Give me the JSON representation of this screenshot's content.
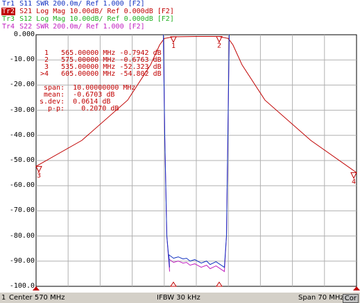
{
  "traces": [
    {
      "tag": "Tr1",
      "param": "S11",
      "fmt": "SWR 200.0m/ Ref 1.000 [F2]",
      "color": "#1030c0",
      "active": false
    },
    {
      "tag": "Tr2",
      "param": "S21",
      "fmt": "Log Mag 10.00dB/ Ref 0.000dB [F2]",
      "color": "#c00000",
      "active": true
    },
    {
      "tag": "Tr3",
      "param": "S12",
      "fmt": "Log Mag 10.00dB/ Ref 0.000dB [F2]",
      "color": "#20b020",
      "active": false
    },
    {
      "tag": "Tr4",
      "param": "S22",
      "fmt": "SWR 200.0m/ Ref 1.000 [F2]",
      "color": "#c020c0",
      "active": false
    }
  ],
  "y_labels": [
    "0.000",
    "-10.00",
    "-20.00",
    "-30.00",
    "-40.00",
    "-50.00",
    "-60.00",
    "-70.00",
    "-80.00",
    "-90.00",
    "-100.0"
  ],
  "markers": [
    {
      "id": " 1",
      "freq": " 565.00000 MHz",
      "value": "-0.7942 dB"
    },
    {
      "id": " 2",
      "freq": " 575.00000 MHz",
      "value": "-0.6763 dB"
    },
    {
      "id": " 3",
      "freq": " 535.00000 MHz",
      "value": "-52.323 dB"
    },
    {
      "id": ">4",
      "freq": " 605.00000 MHz",
      "value": "-54.802 dB"
    }
  ],
  "stats": {
    "span_label": "span:",
    "span_value": "10.00000000 MHz",
    "mean_label": "mean:",
    "mean_value": "-0.6703 dB",
    "sdev_label": "s.dev:",
    "sdev_value": "0.0614 dB",
    "pp_label": "p-p:",
    "pp_value": "0.2070 dB"
  },
  "marker_flags": {
    "m1": "1",
    "m2": "2",
    "m3": "3",
    "m4": "4"
  },
  "status": {
    "channel": "1",
    "center": "Center 570 MHz",
    "ifbw": "IFBW 30 kHz",
    "span": "Span 70 MHz",
    "cor": "Cor"
  },
  "chart_data": {
    "type": "line",
    "x_range_mhz": [
      535,
      605
    ],
    "ylim": [
      -100,
      0
    ],
    "grid": true,
    "series": [
      {
        "name": "S21",
        "color": "#c00000",
        "x": [
          535,
          545,
          555,
          560,
          562,
          563,
          565,
          570,
          575,
          577,
          578,
          580,
          585,
          595,
          605
        ],
        "y": [
          -52.3,
          -42,
          -26,
          -12,
          -4,
          -1.5,
          -0.79,
          -0.7,
          -0.68,
          -1.5,
          -4,
          -12,
          -26,
          -42,
          -54.8
        ]
      },
      {
        "name": "S11",
        "color": "#1030c0"
      },
      {
        "name": "S22",
        "color": "#c020c0"
      }
    ]
  }
}
